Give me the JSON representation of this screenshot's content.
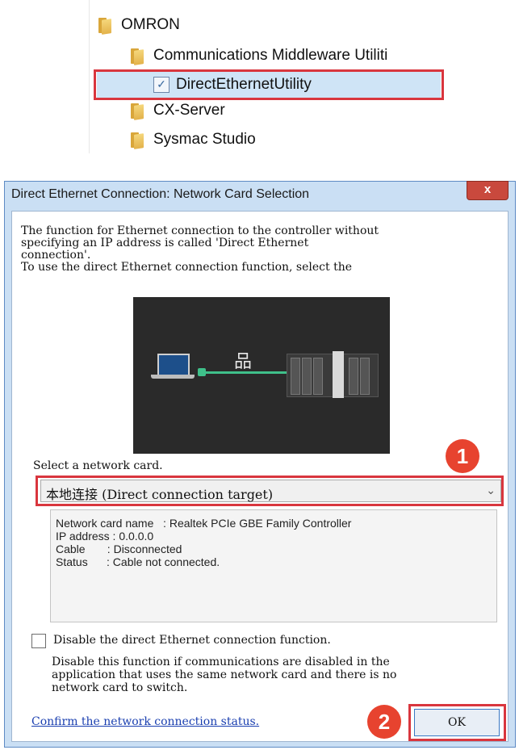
{
  "start_menu": {
    "items": [
      {
        "label": "OMRON",
        "icon": "folder-icon"
      },
      {
        "label": "Communications Middleware Utiliti",
        "icon": "folder-icon"
      },
      {
        "label": "DirectEthernetUtility",
        "icon": "app-icon"
      },
      {
        "label": "CX-Server",
        "icon": "folder-icon"
      },
      {
        "label": "Sysmac Studio",
        "icon": "folder-icon"
      }
    ]
  },
  "dialog": {
    "title": "Direct Ethernet Connection: Network Card Selection",
    "close_label": "x",
    "description": "The function for Ethernet connection to the controller without\nspecifying an IP address is called 'Direct Ethernet\nconnection'.\nTo use the direct Ethernet connection function, select the",
    "select_label": "Select a network card.",
    "selected_card": "本地连接 (Direct connection target)",
    "info": {
      "card_name": "Network card name   : Realtek PCIe GBE Family Controller",
      "ip": "IP address : 0.0.0.0",
      "cable": "Cable       : Disconnected",
      "status": "Status      : Cable not connected."
    },
    "disable_label": "Disable the direct Ethernet connection function.",
    "disable_checked": false,
    "note": "Disable this function if communications are disabled in the\napplication that uses the same network card and there is no\nnetwork card to switch.",
    "link": "Confirm the network connection status.",
    "ok_label": "OK"
  },
  "annotations": {
    "badge_1": "1",
    "badge_2": "2",
    "highlight_color": "#d9363e",
    "badge_color": "#e7432f"
  }
}
